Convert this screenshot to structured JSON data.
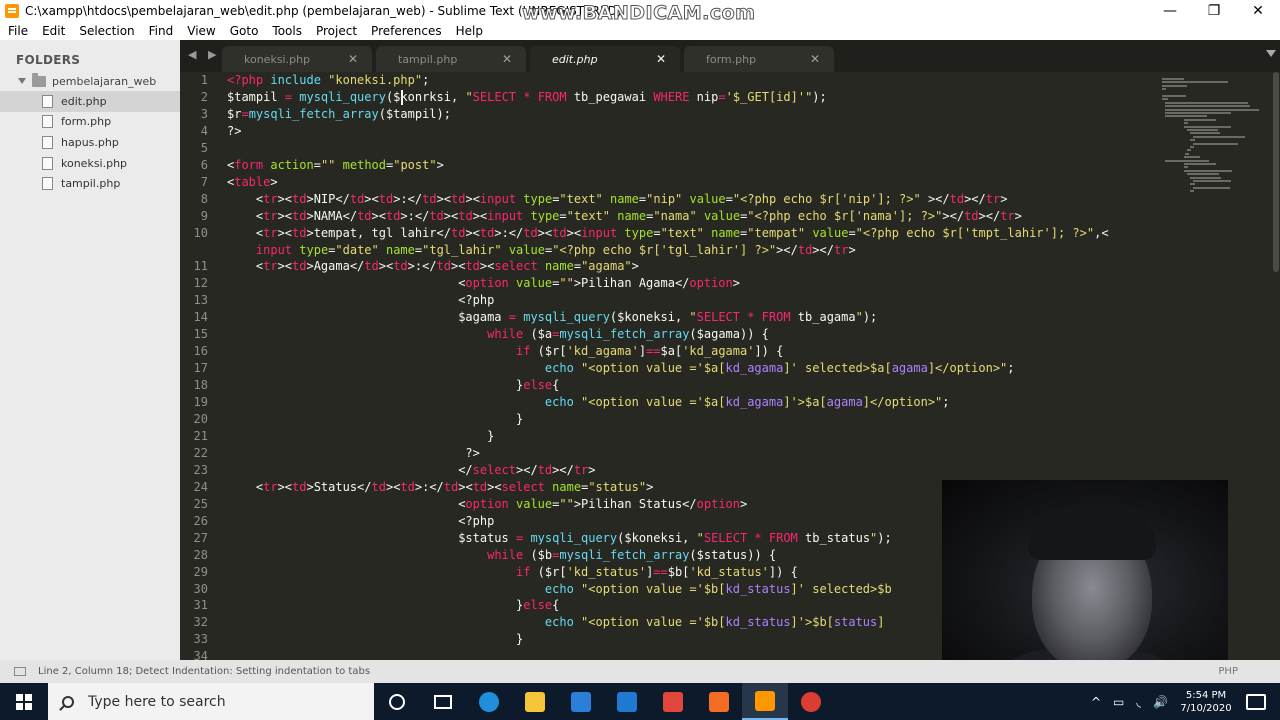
{
  "window": {
    "title": "C:\\xampp\\htdocs\\pembelajaran_web\\edit.php (pembelajaran_web) - Sublime Text (UNREGISTERED)",
    "watermark": "www.BANDICAM.com",
    "minimize": "—",
    "maximize": "❐",
    "close": "✕"
  },
  "menu": [
    "File",
    "Edit",
    "Selection",
    "Find",
    "View",
    "Goto",
    "Tools",
    "Project",
    "Preferences",
    "Help"
  ],
  "sidebar": {
    "title": "FOLDERS",
    "folder": "pembelajaran_web",
    "files": [
      {
        "name": "edit.php",
        "active": true
      },
      {
        "name": "form.php",
        "active": false
      },
      {
        "name": "hapus.php",
        "active": false
      },
      {
        "name": "koneksi.php",
        "active": false
      },
      {
        "name": "tampil.php",
        "active": false
      }
    ]
  },
  "tabs": [
    {
      "label": "koneksi.php",
      "active": false
    },
    {
      "label": "tampil.php",
      "active": false
    },
    {
      "label": "edit.php",
      "active": true
    },
    {
      "label": "form.php",
      "active": false
    }
  ],
  "tab_nav": "◀ ▶",
  "tab_close": "✕",
  "colors": {
    "plain": "#f8f8f2",
    "keyword": "#f92672",
    "string": "#e6db74",
    "function": "#66d9ef",
    "variable": "#ffffff",
    "attribute": "#a6e22e",
    "constant": "#ae81ff"
  },
  "code": [
    {
      "n": "1",
      "t": [
        [
          "k",
          "<?php "
        ],
        [
          "f",
          "include "
        ],
        [
          "s",
          "\"koneksi.php\""
        ],
        [
          "p",
          ";"
        ]
      ]
    },
    {
      "n": "2",
      "t": [
        [
          "p",
          "$tampil "
        ],
        [
          "k",
          "= "
        ],
        [
          "f",
          "mysqli_query"
        ],
        [
          "p",
          "($konrksi, "
        ],
        [
          "s",
          "\""
        ],
        [
          "k",
          "SELECT * FROM "
        ],
        [
          "p",
          "tb_pegawai "
        ],
        [
          "k",
          "WHERE "
        ],
        [
          "p",
          "nip"
        ],
        [
          "k",
          "="
        ],
        [
          "s",
          "'$_GET[id]'\""
        ],
        [
          "p",
          ");"
        ]
      ]
    },
    {
      "n": "3",
      "t": [
        [
          "p",
          "$r"
        ],
        [
          "k",
          "="
        ],
        [
          "f",
          "mysqli_fetch_array"
        ],
        [
          "p",
          "($tampil);"
        ]
      ]
    },
    {
      "n": "4",
      "t": [
        [
          "p",
          "?>"
        ]
      ]
    },
    {
      "n": "5",
      "t": []
    },
    {
      "n": "6",
      "t": [
        [
          "p",
          "<"
        ],
        [
          "k",
          "form "
        ],
        [
          "a",
          "action"
        ],
        [
          "p",
          "="
        ],
        [
          "s",
          "\"\" "
        ],
        [
          "a",
          "method"
        ],
        [
          "p",
          "="
        ],
        [
          "s",
          "\"post\""
        ],
        [
          "p",
          ">"
        ]
      ]
    },
    {
      "n": "7",
      "t": [
        [
          "p",
          "<"
        ],
        [
          "k",
          "table"
        ],
        [
          "p",
          ">"
        ]
      ]
    },
    {
      "n": "8",
      "t": [
        [
          "p",
          "    <"
        ],
        [
          "k",
          "tr"
        ],
        [
          "p",
          "><"
        ],
        [
          "k",
          "td"
        ],
        [
          "p",
          ">NIP</"
        ],
        [
          "k",
          "td"
        ],
        [
          "p",
          "><"
        ],
        [
          "k",
          "td"
        ],
        [
          "p",
          ">:</"
        ],
        [
          "k",
          "td"
        ],
        [
          "p",
          "><"
        ],
        [
          "k",
          "td"
        ],
        [
          "p",
          "><"
        ],
        [
          "k",
          "input "
        ],
        [
          "a",
          "type"
        ],
        [
          "p",
          "="
        ],
        [
          "s",
          "\"text\" "
        ],
        [
          "a",
          "name"
        ],
        [
          "p",
          "="
        ],
        [
          "s",
          "\"nip\" "
        ],
        [
          "a",
          "value"
        ],
        [
          "p",
          "="
        ],
        [
          "s",
          "\"<?php echo $r['nip']; ?>\" "
        ],
        [
          "p",
          "></"
        ],
        [
          "k",
          "td"
        ],
        [
          "p",
          "></"
        ],
        [
          "k",
          "tr"
        ],
        [
          "p",
          ">"
        ]
      ]
    },
    {
      "n": "9",
      "t": [
        [
          "p",
          "    <"
        ],
        [
          "k",
          "tr"
        ],
        [
          "p",
          "><"
        ],
        [
          "k",
          "td"
        ],
        [
          "p",
          ">NAMA</"
        ],
        [
          "k",
          "td"
        ],
        [
          "p",
          "><"
        ],
        [
          "k",
          "td"
        ],
        [
          "p",
          ">:</"
        ],
        [
          "k",
          "td"
        ],
        [
          "p",
          "><"
        ],
        [
          "k",
          "td"
        ],
        [
          "p",
          "><"
        ],
        [
          "k",
          "input "
        ],
        [
          "a",
          "type"
        ],
        [
          "p",
          "="
        ],
        [
          "s",
          "\"text\" "
        ],
        [
          "a",
          "name"
        ],
        [
          "p",
          "="
        ],
        [
          "s",
          "\"nama\" "
        ],
        [
          "a",
          "value"
        ],
        [
          "p",
          "="
        ],
        [
          "s",
          "\"<?php echo $r['nama']; ?>\""
        ],
        [
          "p",
          "></"
        ],
        [
          "k",
          "td"
        ],
        [
          "p",
          "></"
        ],
        [
          "k",
          "tr"
        ],
        [
          "p",
          ">"
        ]
      ]
    },
    {
      "n": "10",
      "t": [
        [
          "p",
          "    <"
        ],
        [
          "k",
          "tr"
        ],
        [
          "p",
          "><"
        ],
        [
          "k",
          "td"
        ],
        [
          "p",
          ">tempat, tgl lahir</"
        ],
        [
          "k",
          "td"
        ],
        [
          "p",
          "><"
        ],
        [
          "k",
          "td"
        ],
        [
          "p",
          ">:</"
        ],
        [
          "k",
          "td"
        ],
        [
          "p",
          "><"
        ],
        [
          "k",
          "td"
        ],
        [
          "p",
          "><"
        ],
        [
          "k",
          "input "
        ],
        [
          "a",
          "type"
        ],
        [
          "p",
          "="
        ],
        [
          "s",
          "\"text\" "
        ],
        [
          "a",
          "name"
        ],
        [
          "p",
          "="
        ],
        [
          "s",
          "\"tempat\" "
        ],
        [
          "a",
          "value"
        ],
        [
          "p",
          "="
        ],
        [
          "s",
          "\"<?php echo $r['tmpt_lahir']; ?>\""
        ],
        [
          "p",
          ",<"
        ]
      ]
    },
    {
      "n": "",
      "t": [
        [
          "p",
          "    "
        ],
        [
          "k",
          "input "
        ],
        [
          "a",
          "type"
        ],
        [
          "p",
          "="
        ],
        [
          "s",
          "\"date\" "
        ],
        [
          "a",
          "name"
        ],
        [
          "p",
          "="
        ],
        [
          "s",
          "\"tgl_lahir\" "
        ],
        [
          "a",
          "value"
        ],
        [
          "p",
          "="
        ],
        [
          "s",
          "\"<?php echo $r['tgl_lahir'] ?>\""
        ],
        [
          "p",
          "></"
        ],
        [
          "k",
          "td"
        ],
        [
          "p",
          "></"
        ],
        [
          "k",
          "tr"
        ],
        [
          "p",
          ">"
        ]
      ]
    },
    {
      "n": "11",
      "t": [
        [
          "p",
          "    <"
        ],
        [
          "k",
          "tr"
        ],
        [
          "p",
          "><"
        ],
        [
          "k",
          "td"
        ],
        [
          "p",
          ">Agama</"
        ],
        [
          "k",
          "td"
        ],
        [
          "p",
          "><"
        ],
        [
          "k",
          "td"
        ],
        [
          "p",
          ">:</"
        ],
        [
          "k",
          "td"
        ],
        [
          "p",
          "><"
        ],
        [
          "k",
          "td"
        ],
        [
          "p",
          "><"
        ],
        [
          "k",
          "select "
        ],
        [
          "a",
          "name"
        ],
        [
          "p",
          "="
        ],
        [
          "s",
          "\"agama\""
        ],
        [
          "p",
          ">"
        ]
      ]
    },
    {
      "n": "12",
      "t": [
        [
          "p",
          "                                <"
        ],
        [
          "k",
          "option "
        ],
        [
          "a",
          "value"
        ],
        [
          "p",
          "="
        ],
        [
          "s",
          "\"\""
        ],
        [
          "p",
          ">Pilihan Agama</"
        ],
        [
          "k",
          "option"
        ],
        [
          "p",
          ">"
        ]
      ]
    },
    {
      "n": "13",
      "t": [
        [
          "p",
          "                                <?php"
        ]
      ]
    },
    {
      "n": "14",
      "t": [
        [
          "p",
          "                                $agama "
        ],
        [
          "k",
          "= "
        ],
        [
          "f",
          "mysqli_query"
        ],
        [
          "p",
          "($koneksi, "
        ],
        [
          "s",
          "\""
        ],
        [
          "k",
          "SELECT * FROM "
        ],
        [
          "p",
          "tb_agama"
        ],
        [
          "s",
          "\""
        ],
        [
          "p",
          ");"
        ]
      ]
    },
    {
      "n": "15",
      "t": [
        [
          "p",
          "                                    "
        ],
        [
          "k",
          "while "
        ],
        [
          "p",
          "($a"
        ],
        [
          "k",
          "="
        ],
        [
          "f",
          "mysqli_fetch_array"
        ],
        [
          "p",
          "($agama)) {"
        ]
      ]
    },
    {
      "n": "16",
      "t": [
        [
          "p",
          "                                        "
        ],
        [
          "k",
          "if "
        ],
        [
          "p",
          "($r["
        ],
        [
          "s",
          "'kd_agama'"
        ],
        [
          "p",
          "]"
        ],
        [
          "k",
          "=="
        ],
        [
          "p",
          "$a["
        ],
        [
          "s",
          "'kd_agama'"
        ],
        [
          "p",
          "]) {"
        ]
      ]
    },
    {
      "n": "17",
      "t": [
        [
          "p",
          "                                            "
        ],
        [
          "f",
          "echo "
        ],
        [
          "s",
          "\"<option value ='$a["
        ],
        [
          "c",
          "kd_agama"
        ],
        [
          "s",
          "]' selected>$a["
        ],
        [
          "c",
          "agama"
        ],
        [
          "s",
          "]</option>\""
        ],
        [
          "p",
          ";"
        ]
      ]
    },
    {
      "n": "18",
      "t": [
        [
          "p",
          "                                        }"
        ],
        [
          "k",
          "else"
        ],
        [
          "p",
          "{"
        ]
      ]
    },
    {
      "n": "19",
      "t": [
        [
          "p",
          "                                            "
        ],
        [
          "f",
          "echo "
        ],
        [
          "s",
          "\"<option value ='$a["
        ],
        [
          "c",
          "kd_agama"
        ],
        [
          "s",
          "]'>$a["
        ],
        [
          "c",
          "agama"
        ],
        [
          "s",
          "]</option>\""
        ],
        [
          "p",
          ";"
        ]
      ]
    },
    {
      "n": "20",
      "t": [
        [
          "p",
          "                                        }"
        ]
      ]
    },
    {
      "n": "21",
      "t": [
        [
          "p",
          "                                    }"
        ]
      ]
    },
    {
      "n": "22",
      "t": [
        [
          "p",
          "                                 ?>"
        ]
      ]
    },
    {
      "n": "23",
      "t": [
        [
          "p",
          "                                </"
        ],
        [
          "k",
          "select"
        ],
        [
          "p",
          "></"
        ],
        [
          "k",
          "td"
        ],
        [
          "p",
          "></"
        ],
        [
          "k",
          "tr"
        ],
        [
          "p",
          ">"
        ]
      ]
    },
    {
      "n": "24",
      "t": [
        [
          "p",
          "    <"
        ],
        [
          "k",
          "tr"
        ],
        [
          "p",
          "><"
        ],
        [
          "k",
          "td"
        ],
        [
          "p",
          ">Status</"
        ],
        [
          "k",
          "td"
        ],
        [
          "p",
          "><"
        ],
        [
          "k",
          "td"
        ],
        [
          "p",
          ">:</"
        ],
        [
          "k",
          "td"
        ],
        [
          "p",
          "><"
        ],
        [
          "k",
          "td"
        ],
        [
          "p",
          "><"
        ],
        [
          "k",
          "select "
        ],
        [
          "a",
          "name"
        ],
        [
          "p",
          "="
        ],
        [
          "s",
          "\"status\""
        ],
        [
          "p",
          ">"
        ]
      ]
    },
    {
      "n": "25",
      "t": [
        [
          "p",
          "                                <"
        ],
        [
          "k",
          "option "
        ],
        [
          "a",
          "value"
        ],
        [
          "p",
          "="
        ],
        [
          "s",
          "\"\""
        ],
        [
          "p",
          ">Pilihan Status</"
        ],
        [
          "k",
          "option"
        ],
        [
          "p",
          ">"
        ]
      ]
    },
    {
      "n": "26",
      "t": [
        [
          "p",
          "                                <?php"
        ]
      ]
    },
    {
      "n": "27",
      "t": [
        [
          "p",
          "                                $status "
        ],
        [
          "k",
          "= "
        ],
        [
          "f",
          "mysqli_query"
        ],
        [
          "p",
          "($koneksi, "
        ],
        [
          "s",
          "\""
        ],
        [
          "k",
          "SELECT * FROM "
        ],
        [
          "p",
          "tb_status"
        ],
        [
          "s",
          "\""
        ],
        [
          "p",
          ");"
        ]
      ]
    },
    {
      "n": "28",
      "t": [
        [
          "p",
          "                                    "
        ],
        [
          "k",
          "while "
        ],
        [
          "p",
          "($b"
        ],
        [
          "k",
          "="
        ],
        [
          "f",
          "mysqli_fetch_array"
        ],
        [
          "p",
          "($status)) {"
        ]
      ]
    },
    {
      "n": "29",
      "t": [
        [
          "p",
          "                                        "
        ],
        [
          "k",
          "if "
        ],
        [
          "p",
          "($r["
        ],
        [
          "s",
          "'kd_status'"
        ],
        [
          "p",
          "]"
        ],
        [
          "k",
          "=="
        ],
        [
          "p",
          "$b["
        ],
        [
          "s",
          "'kd_status'"
        ],
        [
          "p",
          "]) {"
        ]
      ]
    },
    {
      "n": "30",
      "t": [
        [
          "p",
          "                                            "
        ],
        [
          "f",
          "echo "
        ],
        [
          "s",
          "\"<option value ='$b["
        ],
        [
          "c",
          "kd_status"
        ],
        [
          "s",
          "]' selected>$b"
        ]
      ]
    },
    {
      "n": "31",
      "t": [
        [
          "p",
          "                                        }"
        ],
        [
          "k",
          "else"
        ],
        [
          "p",
          "{"
        ]
      ]
    },
    {
      "n": "32",
      "t": [
        [
          "p",
          "                                            "
        ],
        [
          "f",
          "echo "
        ],
        [
          "s",
          "\"<option value ='$b["
        ],
        [
          "c",
          "kd_status"
        ],
        [
          "s",
          "]'>$b["
        ],
        [
          "c",
          "status"
        ],
        [
          "s",
          "]"
        ]
      ]
    },
    {
      "n": "33",
      "t": [
        [
          "p",
          "                                        }"
        ]
      ]
    },
    {
      "n": "34",
      "t": []
    }
  ],
  "status": {
    "text": "Line 2, Column 18; Detect Indentation: Setting indentation to tabs",
    "right": "PHP"
  },
  "taskbar": {
    "search_placeholder": "Type here to search",
    "apps": [
      {
        "name": "edge-icon",
        "color": "#1e8fd8"
      },
      {
        "name": "file-explorer-icon",
        "color": "#f4c43a"
      },
      {
        "name": "store-icon",
        "color": "#2c7fd8"
      },
      {
        "name": "mail-icon",
        "color": "#1f78d1"
      },
      {
        "name": "gift-icon",
        "color": "#e2463b"
      },
      {
        "name": "xampp-icon",
        "color": "#f36c24"
      },
      {
        "name": "sublime-icon",
        "color": "#ff9800"
      },
      {
        "name": "chrome-icon",
        "color": "#dc3d33"
      }
    ],
    "tray": [
      "^",
      "▭",
      "◟",
      "🔊"
    ],
    "time": "5:54 PM",
    "date": "7/10/2020"
  }
}
